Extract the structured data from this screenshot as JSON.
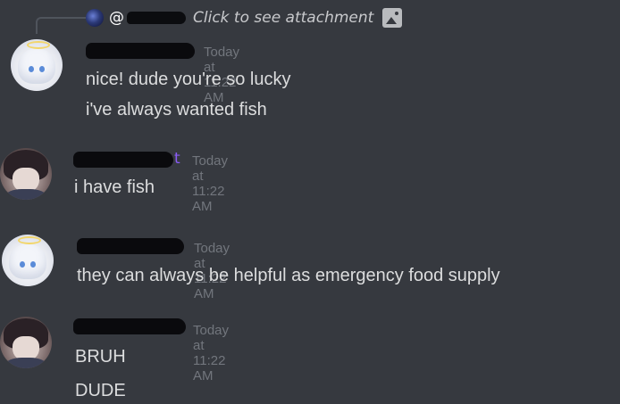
{
  "reply": {
    "at_symbol": "@",
    "text": "Click to see attachment",
    "icon": "image-icon"
  },
  "messages": [
    {
      "timestamp": "Today at 11:22 AM",
      "lines": [
        "nice! dude you're so lucky",
        "i've always wanted fish"
      ]
    },
    {
      "name_tail": "t",
      "timestamp": "Today at 11:22 AM",
      "lines": [
        "i have fish"
      ]
    },
    {
      "timestamp": "Today at 11:22 AM",
      "lines": [
        "they can always be helpful as emergency food supply"
      ]
    },
    {
      "timestamp": "Today at 11:22 AM",
      "lines": [
        "BRUH",
        "DUDE"
      ]
    }
  ]
}
